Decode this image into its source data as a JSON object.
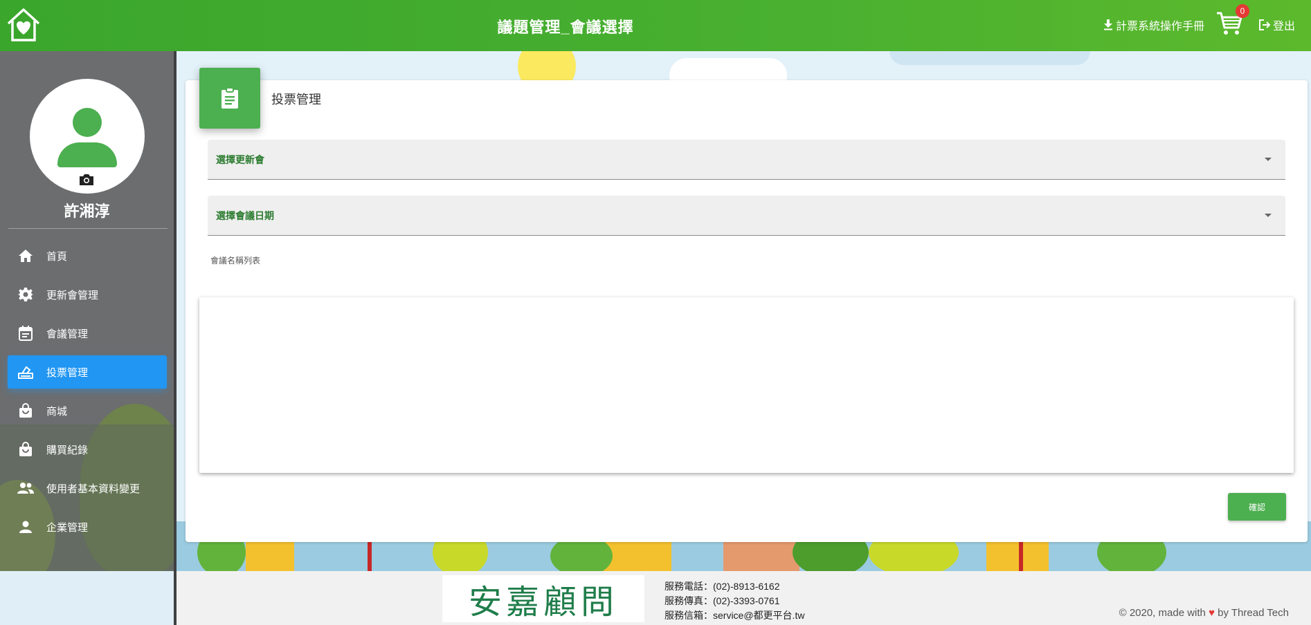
{
  "header": {
    "title": "議題管理_會議選擇",
    "manual_label": "計票系統操作手冊",
    "cart_count": "0",
    "logout_label": "登出"
  },
  "sidebar": {
    "user_name": "許湘淳",
    "items": [
      {
        "label": "首頁",
        "icon": "home-icon"
      },
      {
        "label": "更新會管理",
        "icon": "gear-icon"
      },
      {
        "label": "會議管理",
        "icon": "calendar-icon"
      },
      {
        "label": "投票管理",
        "icon": "ballot-icon",
        "active": true
      },
      {
        "label": "商城",
        "icon": "shopping-bag-icon"
      },
      {
        "label": "購買紀錄",
        "icon": "shopping-bag-icon"
      },
      {
        "label": "使用者基本資料變更",
        "icon": "users-icon"
      },
      {
        "label": "企業管理",
        "icon": "person-icon"
      }
    ]
  },
  "main": {
    "card_title": "投票管理",
    "select_association_label": "選擇更新會",
    "select_meeting_date_label": "選擇會議日期",
    "meeting_list_label": "會議名稱列表",
    "confirm_label": "確認"
  },
  "footer": {
    "logo_text": "安嘉顧問",
    "phone": "服務電話：(02)-8913-6162",
    "fax": "服務傳真：(02)-3393-0761",
    "email": "服務信箱：service@都更平台.tw",
    "credit_prefix": "© 2020, made with",
    "credit_suffix": "by Thread Tech"
  },
  "colors": {
    "header_green": "#49b030",
    "accent_green": "#4caf50",
    "active_nav_blue": "#2196f3",
    "cart_badge_red": "#e53935"
  }
}
